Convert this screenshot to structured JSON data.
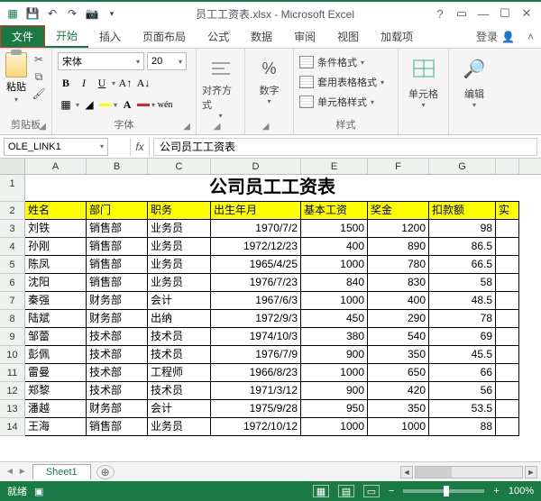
{
  "title": "员工工资表.xlsx - Microsoft Excel",
  "tabs": {
    "file": "文件",
    "home": "开始",
    "insert": "插入",
    "layout": "页面布局",
    "formulas": "公式",
    "data": "数据",
    "review": "审阅",
    "view": "视图",
    "addins": "加载项",
    "login": "登录"
  },
  "ribbon": {
    "clipboard": {
      "paste": "粘贴",
      "label": "剪贴板"
    },
    "font": {
      "name": "宋体",
      "size": "20",
      "label": "字体"
    },
    "align": {
      "btn": "对齐方式",
      "label": ""
    },
    "number": {
      "btn": "数字",
      "pct": "%",
      "label": ""
    },
    "styles": {
      "cond": "条件格式",
      "table": "套用表格格式",
      "cell": "单元格样式",
      "label": "样式"
    },
    "cells": {
      "btn": "单元格"
    },
    "edit": {
      "btn": "编辑"
    }
  },
  "namebox": "OLE_LINK1",
  "formula": "公司员工工资表",
  "cols": [
    "A",
    "B",
    "C",
    "D",
    "E",
    "F",
    "G"
  ],
  "table": {
    "title": "公司员工工资表",
    "headers": [
      "姓名",
      "部门",
      "职务",
      "出生年月",
      "基本工资",
      "奖金",
      "扣款额",
      "实"
    ],
    "rows": [
      [
        "刘铁",
        "销售部",
        "业务员",
        "1970/7/2",
        "1500",
        "1200",
        "98",
        ""
      ],
      [
        "孙刚",
        "销售部",
        "业务员",
        "1972/12/23",
        "400",
        "890",
        "86.5",
        ""
      ],
      [
        "陈凤",
        "销售部",
        "业务员",
        "1965/4/25",
        "1000",
        "780",
        "66.5",
        ""
      ],
      [
        "沈阳",
        "销售部",
        "业务员",
        "1976/7/23",
        "840",
        "830",
        "58",
        ""
      ],
      [
        "秦强",
        "财务部",
        "会计",
        "1967/6/3",
        "1000",
        "400",
        "48.5",
        ""
      ],
      [
        "陆斌",
        "财务部",
        "出纳",
        "1972/9/3",
        "450",
        "290",
        "78",
        ""
      ],
      [
        "邹蕾",
        "技术部",
        "技术员",
        "1974/10/3",
        "380",
        "540",
        "69",
        ""
      ],
      [
        "彭佩",
        "技术部",
        "技术员",
        "1976/7/9",
        "900",
        "350",
        "45.5",
        ""
      ],
      [
        "雷曼",
        "技术部",
        "工程师",
        "1966/8/23",
        "1000",
        "650",
        "66",
        ""
      ],
      [
        "郑黎",
        "技术部",
        "技术员",
        "1971/3/12",
        "900",
        "420",
        "56",
        ""
      ],
      [
        "潘越",
        "财务部",
        "会计",
        "1975/9/28",
        "950",
        "350",
        "53.5",
        ""
      ],
      [
        "王海",
        "销售部",
        "业务员",
        "1972/10/12",
        "1000",
        "1000",
        "88",
        ""
      ]
    ]
  },
  "sheet_tab": "Sheet1",
  "status": {
    "ready": "就绪",
    "zoom": "100%"
  }
}
